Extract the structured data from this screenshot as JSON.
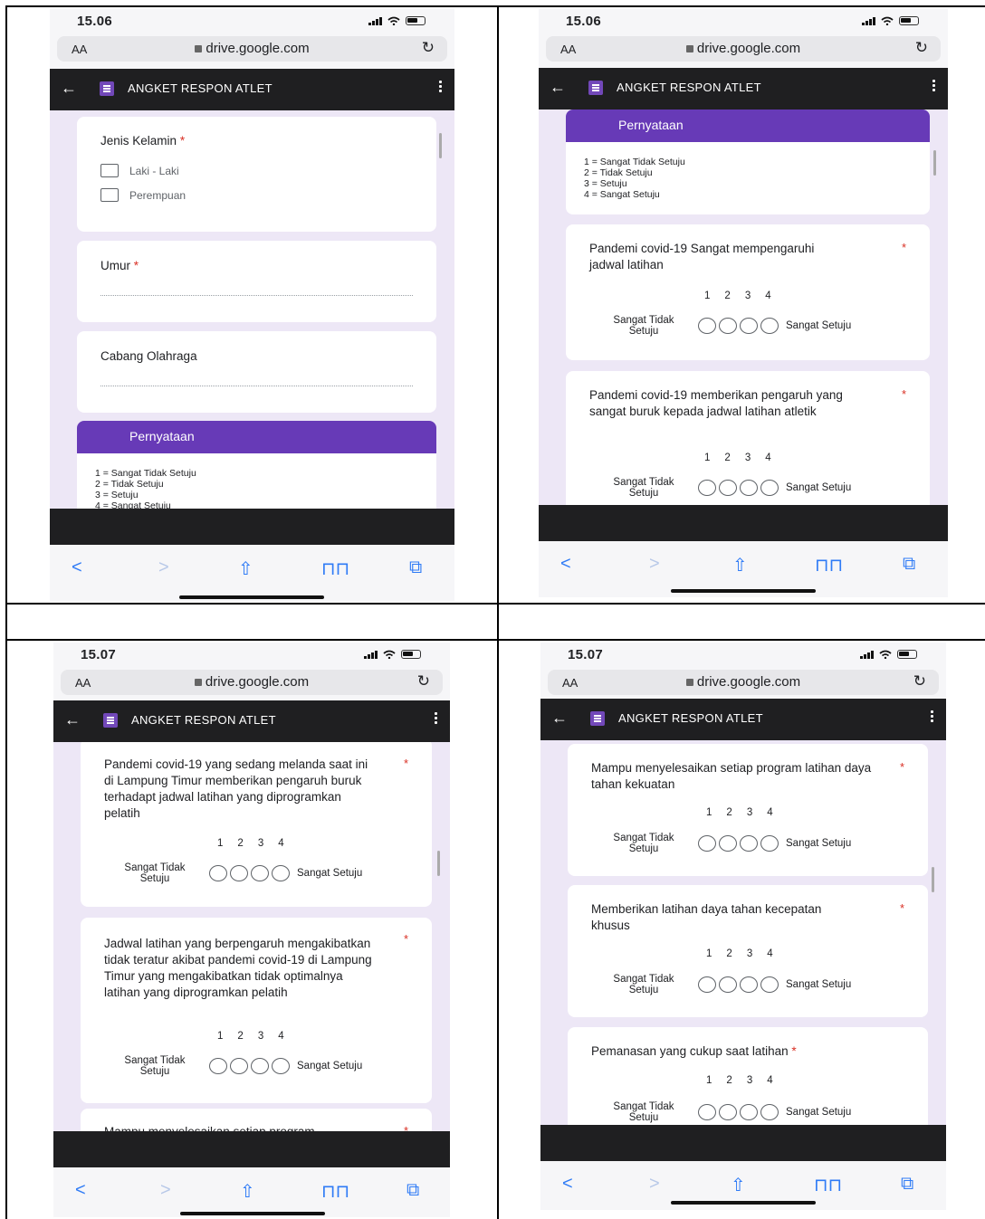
{
  "browser": {
    "aa_label": "AA",
    "url": "drive.google.com",
    "reload_icon": "reload-icon",
    "app_title": "ANGKET RESPON ATLET"
  },
  "panels": [
    {
      "time": "15.06",
      "cards": {
        "gender": {
          "title": "Jenis Kelamin",
          "options": [
            "Laki - Laki",
            "Perempuan"
          ]
        },
        "age": {
          "title": "Umur"
        },
        "sport": {
          "title": "Cabang Olahraga"
        },
        "statement": {
          "header": "Pernyataan"
        }
      }
    },
    {
      "time": "15.06"
    },
    {
      "time": "15.07"
    },
    {
      "time": "15.07"
    }
  ],
  "statement_header": "Pernyataan",
  "legend": [
    "1 = Sangat Tidak Setuju",
    "2 = Tidak Setuju",
    "3 = Setuju",
    "4 = Sangat Setuju"
  ],
  "scale": {
    "numbers": [
      "1",
      "2",
      "3",
      "4"
    ],
    "low": "Sangat Tidak Setuju",
    "high": "Sangat Setuju",
    "required": "*"
  },
  "questions": {
    "q1": "Pandemi covid-19 Sangat mempengaruhi jadwal latihan",
    "q2": "Pandemi covid-19 memberikan pengaruh yang sangat buruk kepada jadwal latihan atletik",
    "q3": "Pandemi covid-19 yang sedang melanda saat ini di Lampung Timur memberikan pengaruh buruk terhadapt jadwal latihan yang diprogramkan pelatih",
    "q4": "Jadwal latihan yang berpengaruh mengakibatkan tidak teratur akibat pandemi covid-19 di Lampung Timur yang mengakibatkan tidak optimalnya latihan yang diprogramkan pelatih",
    "q5_partial": "Mampu menyelesaikan setiap program",
    "q5": "Mampu menyelesaikan setiap program latihan daya tahan kekuatan",
    "q6": "Memberikan latihan daya tahan kecepatan khusus",
    "q7": "Pemanasan yang cukup saat latihan"
  },
  "toolbar_icons": [
    "back-arrow-icon",
    "forward-arrow-icon",
    "share-icon",
    "bookmarks-icon",
    "tabs-icon"
  ]
}
